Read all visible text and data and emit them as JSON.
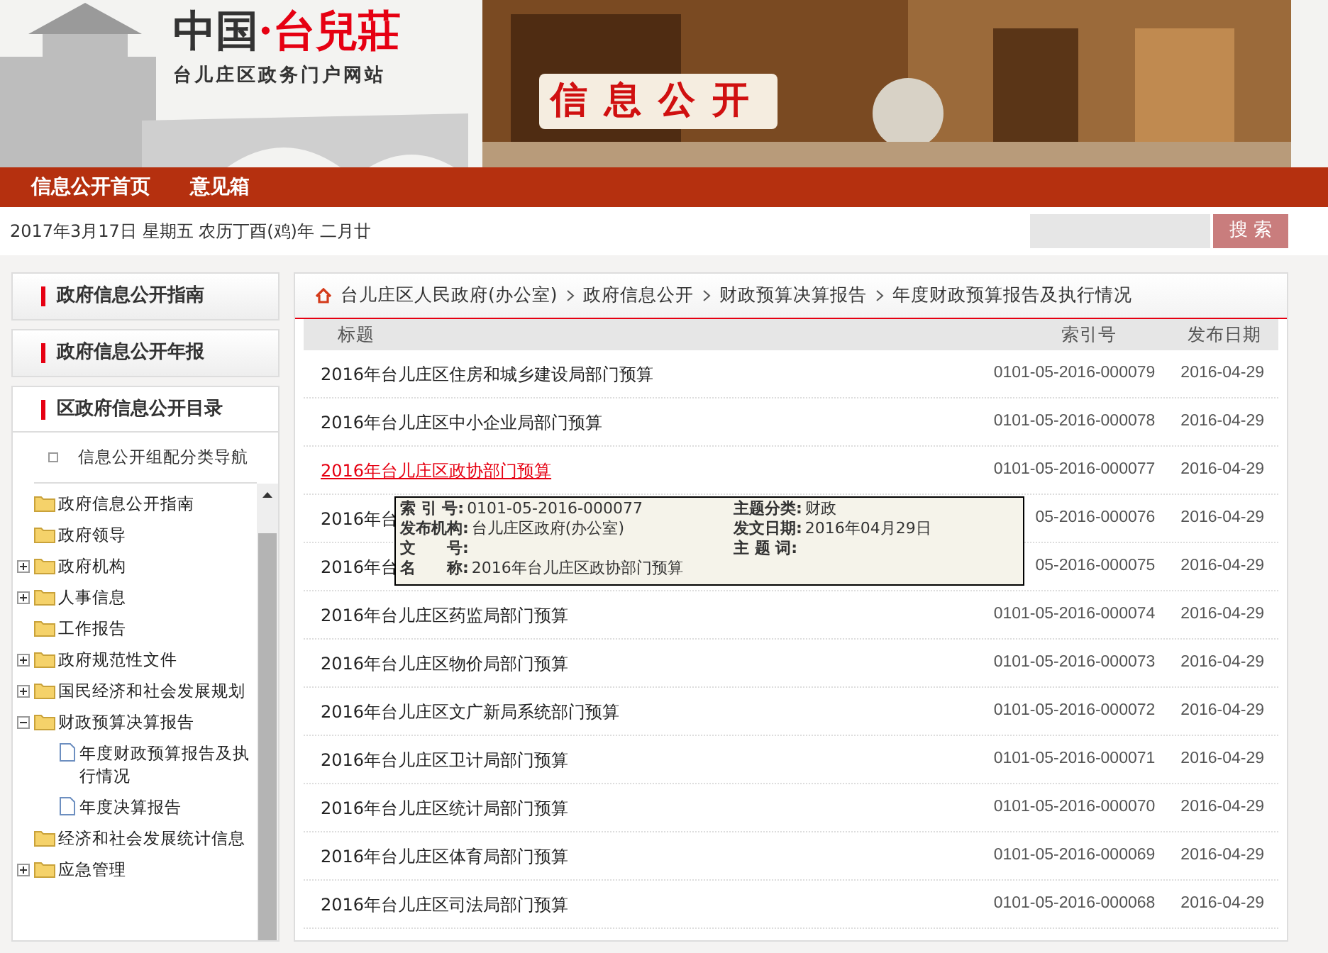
{
  "banner": {
    "logo_main": "中国",
    "logo_accent": "·台兒莊",
    "logo_sub": "台儿庄区政务门户网站",
    "section_title": "信息公开"
  },
  "nav": [
    {
      "label": "信息公开首页"
    },
    {
      "label": "意见箱"
    }
  ],
  "date_line": "2017年3月17日 星期五 农历丁酉(鸡)年 二月廿",
  "search": {
    "button": "搜 索"
  },
  "sidebar": {
    "panels": [
      {
        "title": "政府信息公开指南"
      },
      {
        "title": "政府信息公开年报"
      }
    ],
    "catalog": {
      "title": "区政府信息公开目录",
      "subnav": "信息公开组配分类导航",
      "tree": [
        {
          "label": "政府信息公开指南",
          "kind": "folder"
        },
        {
          "label": "政府领导",
          "kind": "folder"
        },
        {
          "label": "政府机构",
          "kind": "folder",
          "expanded": false
        },
        {
          "label": "人事信息",
          "kind": "folder",
          "expanded": false
        },
        {
          "label": "工作报告",
          "kind": "folder"
        },
        {
          "label": "政府规范性文件",
          "kind": "folder",
          "expanded": false
        },
        {
          "label": "国民经济和社会发展规划",
          "kind": "folder",
          "expanded": false
        },
        {
          "label": "财政预算决算报告",
          "kind": "folder",
          "expanded": true,
          "children": [
            {
              "label": "年度财政预算报告及执行情况",
              "kind": "doc"
            },
            {
              "label": "年度决算报告",
              "kind": "doc"
            }
          ]
        },
        {
          "label": "经济和社会发展统计信息",
          "kind": "folder"
        },
        {
          "label": "应急管理",
          "kind": "folder",
          "expanded": false
        }
      ]
    }
  },
  "breadcrumb": [
    "台儿庄区人民政府(办公室)",
    "政府信息公开",
    "财政预算决算报告",
    "年度财政预算报告及执行情况"
  ],
  "table": {
    "columns": [
      "标题",
      "索引号",
      "发布日期"
    ],
    "rows": [
      {
        "title": "2016年台儿庄区住房和城乡建设局部门预算",
        "index": "0101-05-2016-000079",
        "date": "2016-04-29",
        "selected": false
      },
      {
        "title": "2016年台儿庄区中小企业局部门预算",
        "index": "0101-05-2016-000078",
        "date": "2016-04-29",
        "selected": false
      },
      {
        "title": "2016年台儿庄区政协部门预算",
        "index": "0101-05-2016-000077",
        "date": "2016-04-29",
        "selected": true
      },
      {
        "title": "2016年台",
        "index": "05-2016-000076",
        "date": "2016-04-29",
        "selected": false
      },
      {
        "title": "2016年台",
        "index": "05-2016-000075",
        "date": "2016-04-29",
        "selected": false
      },
      {
        "title": "2016年台儿庄区药监局部门预算",
        "index": "0101-05-2016-000074",
        "date": "2016-04-29",
        "selected": false
      },
      {
        "title": "2016年台儿庄区物价局部门预算",
        "index": "0101-05-2016-000073",
        "date": "2016-04-29",
        "selected": false
      },
      {
        "title": "2016年台儿庄区文广新局系统部门预算",
        "index": "0101-05-2016-000072",
        "date": "2016-04-29",
        "selected": false
      },
      {
        "title": "2016年台儿庄区卫计局部门预算",
        "index": "0101-05-2016-000071",
        "date": "2016-04-29",
        "selected": false
      },
      {
        "title": "2016年台儿庄区统计局部门预算",
        "index": "0101-05-2016-000070",
        "date": "2016-04-29",
        "selected": false
      },
      {
        "title": "2016年台儿庄区体育局部门预算",
        "index": "0101-05-2016-000069",
        "date": "2016-04-29",
        "selected": false
      },
      {
        "title": "2016年台儿庄区司法局部门预算",
        "index": "0101-05-2016-000068",
        "date": "2016-04-29",
        "selected": false
      }
    ]
  },
  "tooltip": {
    "fields": [
      {
        "label": "索 引 号:",
        "value": "0101-05-2016-000077"
      },
      {
        "label": "主题分类:",
        "value": "财政"
      },
      {
        "label": "发布机构:",
        "value": "台儿庄区政府(办公室)"
      },
      {
        "label": "发文日期:",
        "value": "2016年04月29日"
      },
      {
        "label": "文　　号:"
      },
      {
        "label": "主 题 词:"
      },
      {
        "label": "名　　称:",
        "value": "2016年台儿庄区政协部门预算"
      }
    ]
  }
}
